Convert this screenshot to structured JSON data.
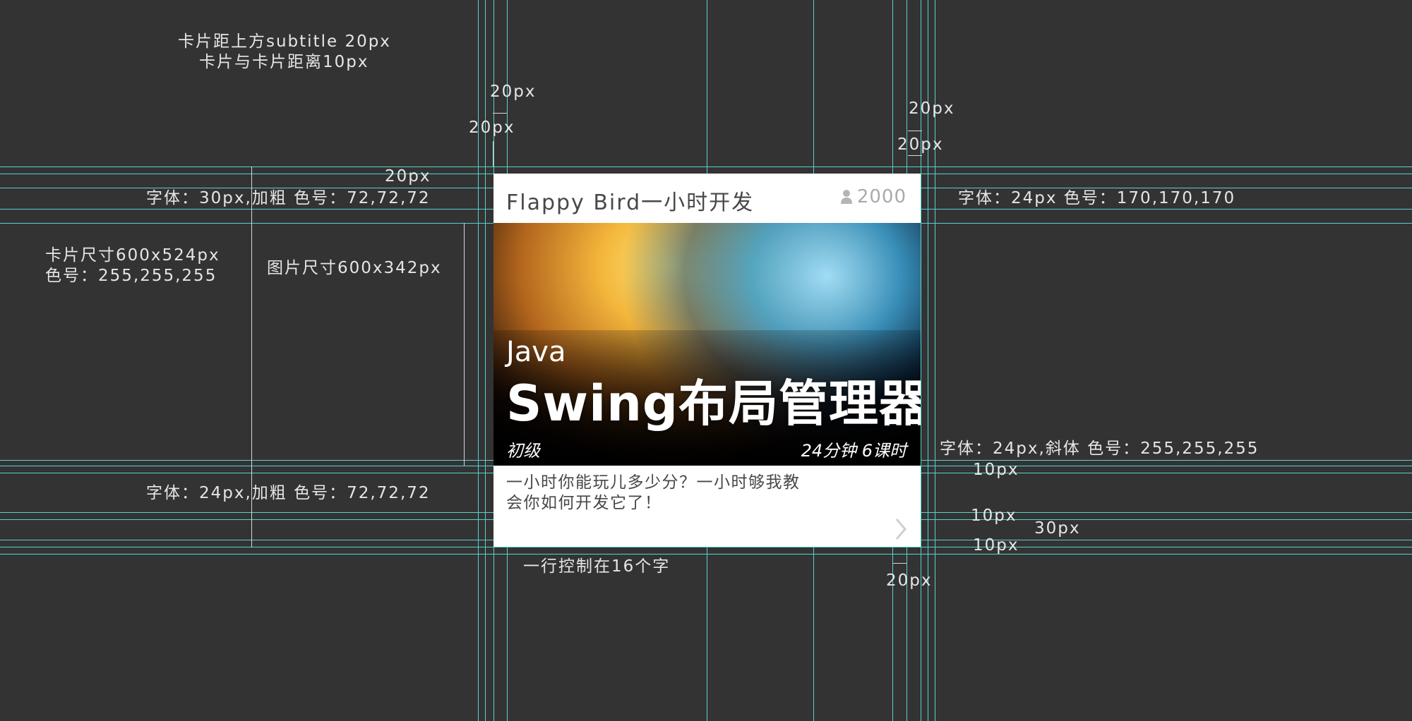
{
  "annotations": {
    "spacing_note_1": "卡片距上方subtitle 20px",
    "spacing_note_2": "卡片与卡片距离10px",
    "left_top_20_a": "20px",
    "left_top_20_b": "20px",
    "right_top_20_a": "20px",
    "right_top_20_b": "20px",
    "header_20": "20px",
    "title_font": "字体：30px,加粗 色号：72,72,72",
    "count_font": "字体：24px 色号：170,170,170",
    "card_size_1": "卡片尺寸600x524px",
    "card_size_2": "色号：255,255,255",
    "image_size": "图片尺寸600x342px",
    "overlay_font": "字体：24px,斜体 色号：255,255,255",
    "desc_font": "字体：24px,加粗 色号：72,72,72",
    "right_10_a": "10px",
    "right_10_b": "10px",
    "right_30": "30px",
    "right_10_c": "10px",
    "line_limit": "一行控制在16个字",
    "bottom_20": "20px"
  },
  "card": {
    "title": "Flappy Bird一小时开发",
    "count": "2000",
    "image": {
      "line1": "Java",
      "line2": "Swing布局管理器"
    },
    "level": "初级",
    "meta": "24分钟  6课时",
    "description": "一小时你能玩儿多少分？一小时够我教会你如何开发它了！"
  },
  "colors": {
    "background": "#333333",
    "guide": "#59d0d0",
    "title": "#484848",
    "count": "#aaaaaa",
    "card": "#ffffff"
  },
  "icons": {
    "user": "user-icon",
    "arrow": "chevron-right-icon"
  }
}
